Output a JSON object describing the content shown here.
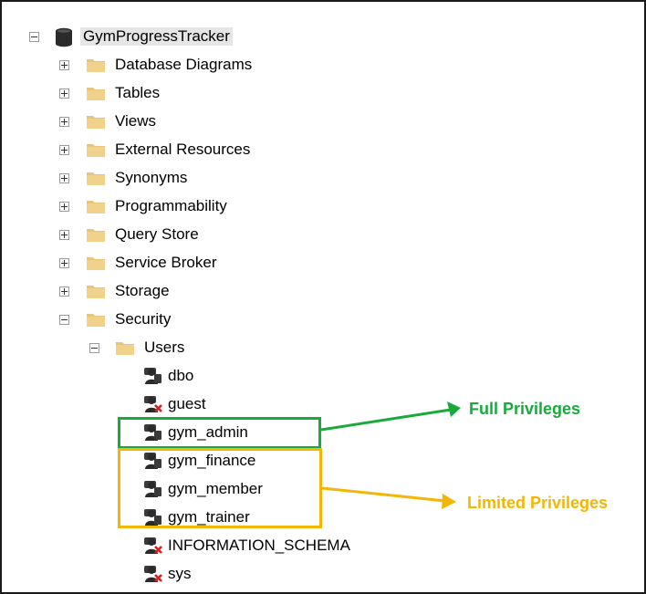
{
  "tree": {
    "root": {
      "label": "GymProgressTracker"
    },
    "folders": [
      {
        "label": "Database Diagrams"
      },
      {
        "label": "Tables"
      },
      {
        "label": "Views"
      },
      {
        "label": "External Resources"
      },
      {
        "label": "Synonyms"
      },
      {
        "label": "Programmability"
      },
      {
        "label": "Query Store"
      },
      {
        "label": "Service Broker"
      },
      {
        "label": "Storage"
      },
      {
        "label": "Security"
      }
    ],
    "security_children": {
      "users_folder": {
        "label": "Users"
      }
    },
    "users": [
      {
        "label": "dbo",
        "icon": "user-icon"
      },
      {
        "label": "guest",
        "icon": "user-disabled-icon"
      },
      {
        "label": "gym_admin",
        "icon": "user-icon"
      },
      {
        "label": "gym_finance",
        "icon": "user-icon"
      },
      {
        "label": "gym_member",
        "icon": "user-icon"
      },
      {
        "label": "gym_trainer",
        "icon": "user-icon"
      },
      {
        "label": "INFORMATION_SCHEMA",
        "icon": "user-disabled-icon"
      },
      {
        "label": "sys",
        "icon": "user-disabled-icon"
      }
    ]
  },
  "annotations": {
    "full": {
      "label": "Full Privileges",
      "color": "#1aaa3c"
    },
    "limited": {
      "label": "Limited Privileges",
      "color": "#f2b705"
    }
  }
}
